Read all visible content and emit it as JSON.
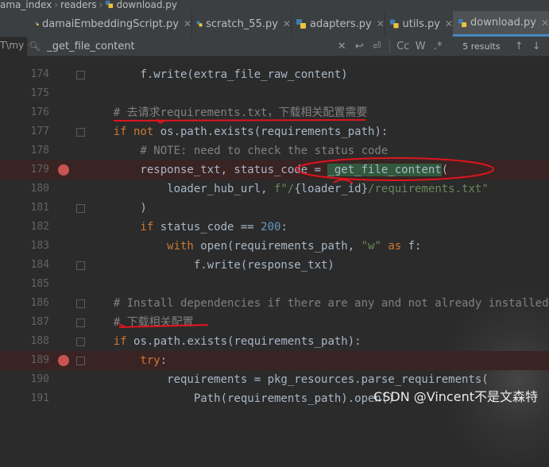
{
  "breadcrumb": {
    "items": [
      "ama_index",
      "readers",
      "download.py"
    ]
  },
  "tabs": [
    {
      "label": "damaiEmbeddingScript.py",
      "active": false
    },
    {
      "label": "scratch_55.py",
      "active": false
    },
    {
      "label": "adapters.py",
      "active": false
    },
    {
      "label": "utils.py",
      "active": false
    },
    {
      "label": "download.py",
      "active": true
    }
  ],
  "left_gutter_text": "T\\my",
  "search": {
    "value": "_get_file_content",
    "results": "5 results",
    "match_case": "Cc",
    "words": "W",
    "regex": ".*"
  },
  "code_lines": [
    {
      "n": "174",
      "parts": [
        [
          "",
          "        f.write(extra_file_raw_content)"
        ]
      ]
    },
    {
      "n": "175",
      "parts": [
        [
          "",
          ""
        ]
      ]
    },
    {
      "n": "176",
      "parts": [
        [
          "cm",
          "    # 去请求requirements.txt，下载相关配置需要"
        ]
      ]
    },
    {
      "n": "177",
      "parts": [
        [
          "kw",
          "    if not "
        ],
        [
          "",
          "os.path.exists(requirements_path):"
        ]
      ]
    },
    {
      "n": "178",
      "parts": [
        [
          "cm",
          "        # NOTE: need to check the status code"
        ]
      ]
    },
    {
      "n": "179",
      "bp": true,
      "parts": [
        [
          "",
          "        response_txt, status_code = "
        ],
        [
          "hl",
          "_get_file_content"
        ],
        [
          "",
          "("
        ]
      ]
    },
    {
      "n": "180",
      "parts": [
        [
          "",
          "            loader_hub_url, "
        ],
        [
          "str",
          "f\"/"
        ],
        [
          "",
          "{loader_id}"
        ],
        [
          "str",
          "/requirements.txt\""
        ]
      ]
    },
    {
      "n": "181",
      "parts": [
        [
          "",
          "        )"
        ]
      ]
    },
    {
      "n": "182",
      "parts": [
        [
          "kw",
          "        if "
        ],
        [
          "",
          "status_code == "
        ],
        [
          "num",
          "200"
        ],
        [
          "",
          ":"
        ]
      ]
    },
    {
      "n": "183",
      "parts": [
        [
          "kw",
          "            with "
        ],
        [
          "",
          "open(requirements_path, "
        ],
        [
          "str",
          "\"w\""
        ],
        [
          "kw",
          " as "
        ],
        [
          "",
          "f:"
        ]
      ]
    },
    {
      "n": "184",
      "parts": [
        [
          "",
          "                f.write(response_txt)"
        ]
      ]
    },
    {
      "n": "185",
      "parts": [
        [
          "",
          ""
        ]
      ]
    },
    {
      "n": "186",
      "parts": [
        [
          "cm",
          "    # Install dependencies if there are any and not already installed"
        ]
      ]
    },
    {
      "n": "187",
      "parts": [
        [
          "cm",
          "    # 下载相关配置"
        ]
      ]
    },
    {
      "n": "188",
      "parts": [
        [
          "kw",
          "    if "
        ],
        [
          "",
          "os.path.exists(requirements_path):"
        ]
      ]
    },
    {
      "n": "189",
      "bp": true,
      "parts": [
        [
          "kw",
          "        try"
        ],
        [
          "",
          ":"
        ]
      ]
    },
    {
      "n": "190",
      "parts": [
        [
          "",
          "            requirements = pkg_resources.parse_requirements("
        ]
      ]
    },
    {
      "n": "191",
      "parts": [
        [
          "",
          "                Path(requirements_path).open()"
        ]
      ]
    }
  ],
  "watermark": "CSDN @Vincent不是文森特",
  "colors": {
    "keyword": "#cc7832",
    "comment": "#808080",
    "string": "#6a8759",
    "number": "#6897bb",
    "breakpoint": "#c75450",
    "match_highlight": "#32593d",
    "annotation_red": "#e0141e"
  }
}
